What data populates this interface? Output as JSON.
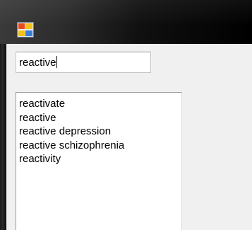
{
  "window": {
    "icon": "application-icon"
  },
  "search": {
    "value": "reactive"
  },
  "suggestions": {
    "items": [
      "reactivate",
      "reactive",
      "reactive depression",
      "reactive schizophrenia",
      "reactivity"
    ]
  }
}
